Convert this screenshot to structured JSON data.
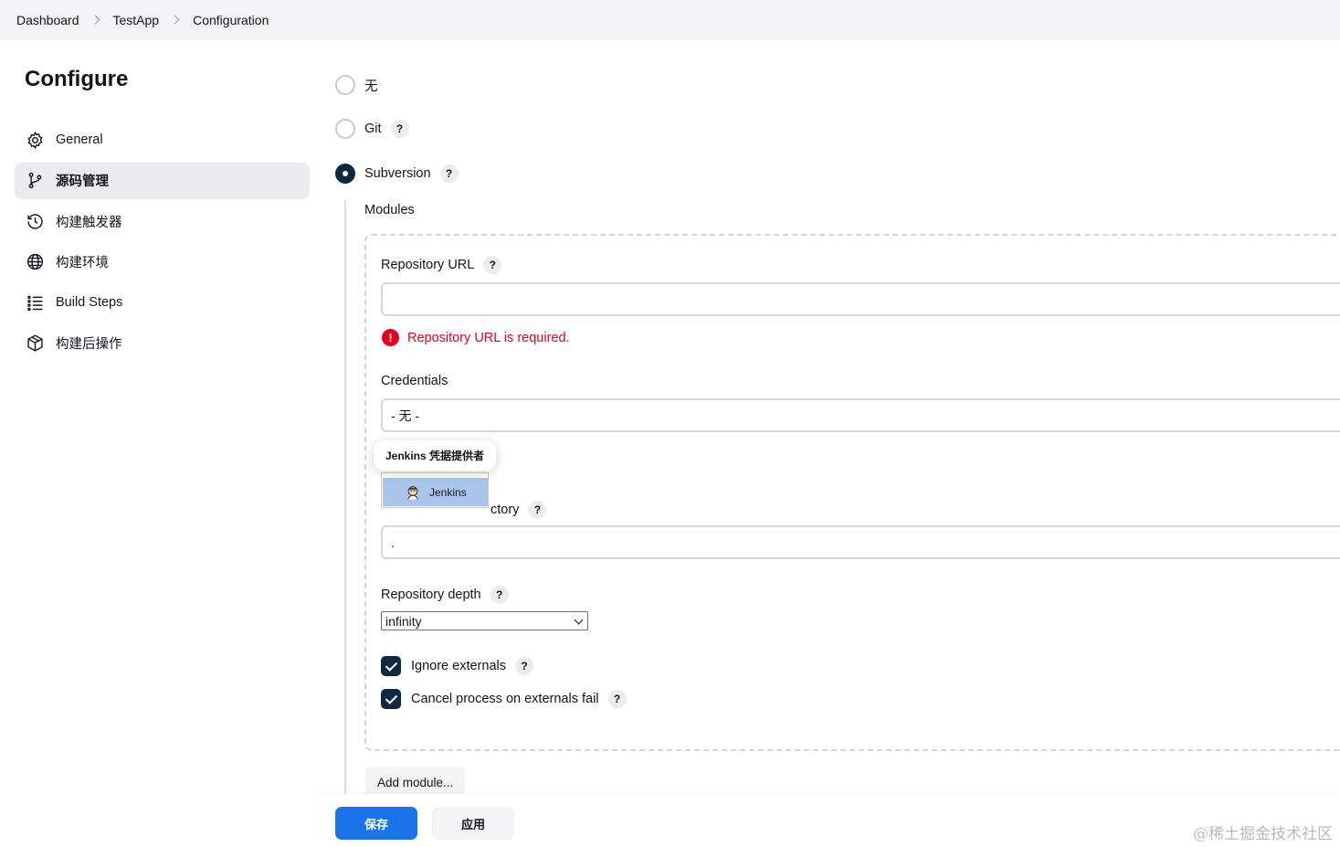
{
  "breadcrumb": [
    "Dashboard",
    "TestApp",
    "Configuration"
  ],
  "page_title": "Configure",
  "sidebar": {
    "items": [
      {
        "label": "General",
        "icon": "gear-icon",
        "active": false
      },
      {
        "label": "源码管理",
        "icon": "branch-icon",
        "active": true
      },
      {
        "label": "构建触发器",
        "icon": "clock-icon",
        "active": false
      },
      {
        "label": "构建环境",
        "icon": "globe-icon",
        "active": false
      },
      {
        "label": "Build Steps",
        "icon": "list-icon",
        "active": false
      },
      {
        "label": "构建后操作",
        "icon": "package-icon",
        "active": false
      }
    ]
  },
  "scm": {
    "options": [
      {
        "label": "无",
        "checked": false,
        "help": false
      },
      {
        "label": "Git",
        "checked": false,
        "help": true
      },
      {
        "label": "Subversion",
        "checked": true,
        "help": true
      }
    ],
    "modules_label": "Modules",
    "help_glyph": "?",
    "repository_url": {
      "label": "Repository URL",
      "value": "",
      "error": "Repository URL is required.",
      "error_glyph": "!"
    },
    "credentials": {
      "label": "Credentials",
      "value": "- 无 -"
    },
    "credentials_popup": {
      "tooltip": "Jenkins 凭据提供者",
      "item": "Jenkins"
    },
    "local_module_directory": {
      "label_visible": "ctory",
      "value": "."
    },
    "repository_depth": {
      "label": "Repository depth",
      "value": "infinity"
    },
    "ignore_externals": {
      "label": "Ignore externals",
      "checked": true
    },
    "cancel_process": {
      "label": "Cancel process on externals fail",
      "checked": true
    },
    "add_module": "Add module..."
  },
  "actions": {
    "save": "保存",
    "apply": "应用"
  },
  "watermark": "@稀土掘金技术社区",
  "colors": {
    "primary": "#1a73e8",
    "dark_control": "#0b2a3f",
    "error": "#e6001f",
    "dropdown_highlight": "#a9c6ea"
  }
}
